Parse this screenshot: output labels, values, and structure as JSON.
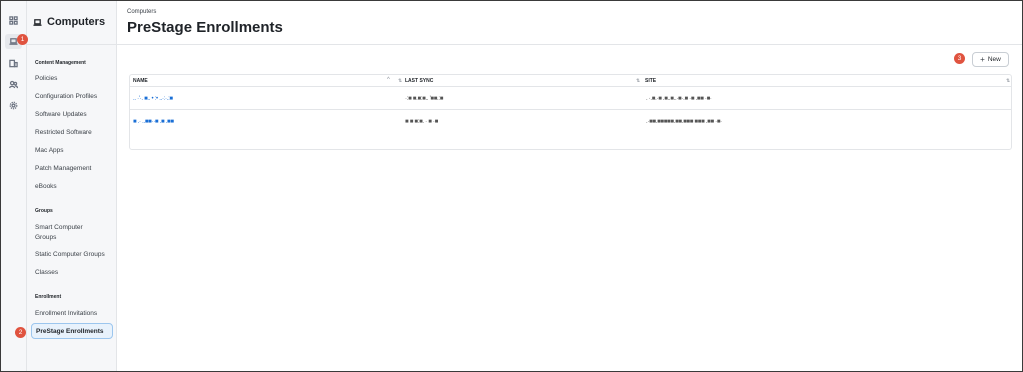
{
  "sidebar": {
    "title": "Computers",
    "sections": [
      {
        "heading": "Content Management",
        "items": [
          "Policies",
          "Configuration Profiles",
          "Software Updates",
          "Restricted Software",
          "Mac Apps",
          "Patch Management",
          "eBooks"
        ]
      },
      {
        "heading": "Groups",
        "items": [
          "Smart Computer Groups",
          "Static Computer Groups",
          "Classes"
        ]
      },
      {
        "heading": "Enrollment",
        "items": [
          "Enrollment Invitations",
          "PreStage Enrollments"
        ]
      }
    ],
    "active_item": "PreStage Enrollments"
  },
  "rail": {
    "icons": [
      "dashboard-icon",
      "computer-icon",
      "devices-icon",
      "users-icon",
      "settings-icon"
    ],
    "active_icon": "computer-icon"
  },
  "header": {
    "breadcrumb": "Computers",
    "title": "PreStage Enrollments"
  },
  "toolbar": {
    "new_label": "New",
    "new_icon": "+"
  },
  "table": {
    "columns": [
      "NAME",
      "LAST SYNC",
      "SITE"
    ],
    "rows": [
      {
        "name": ".. ·'·. ■.. • :• ..·:·.:■",
        "last_sync": "·:■ ■.■:■.. '■■.:■",
        "site": ". ·.■.·■ .■..■..·■·.■ ·■ .■■ ·■·"
      },
      {
        "name": "■ .· ..■■··■ .■ .■■",
        "last_sync": "■ ■ ■:■.   ·  ■ ·■",
        "site": ".·■■.■■■■■.■■.■■■ ■■■ .■■ ·■·"
      }
    ]
  },
  "markers": [
    "1",
    "2",
    "3"
  ],
  "colors": {
    "accent": "#1a6fd6",
    "marker": "#e0533f",
    "active_bg": "#e8f2fc",
    "active_border": "#9cc6ee"
  }
}
